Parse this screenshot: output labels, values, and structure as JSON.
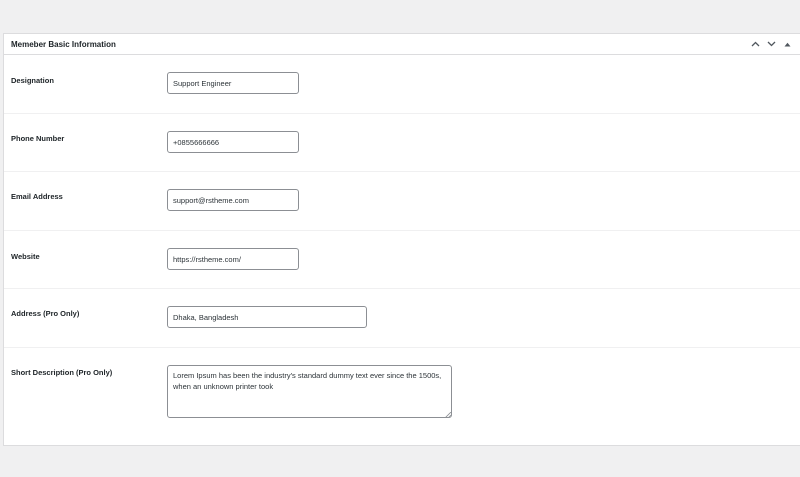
{
  "panel": {
    "title": "Memeber Basic Information",
    "actions": {
      "move_up": "chevron-up-icon",
      "move_down": "chevron-down-icon",
      "toggle": "triangle-up-icon"
    }
  },
  "fields": {
    "designation": {
      "label": "Designation",
      "value": "Support Engineer"
    },
    "phone": {
      "label": "Phone Number",
      "value": "+0855666666"
    },
    "email": {
      "label": "Email Address",
      "value": "support@rstheme.com"
    },
    "website": {
      "label": "Website",
      "value": "https://rstheme.com/"
    },
    "address": {
      "label": "Address (Pro Only)",
      "value": "Dhaka, Bangladesh"
    },
    "description": {
      "label": "Short Description (Pro Only)",
      "value": "Lorem Ipsum has been the industry's standard dummy text ever since the 1500s, when an unknown printer took"
    }
  },
  "colors": {
    "background": "#f0f0f1",
    "panel": "#ffffff",
    "border": "#dcdcde",
    "input_border": "#8c8f94",
    "text": "#1d2327"
  }
}
